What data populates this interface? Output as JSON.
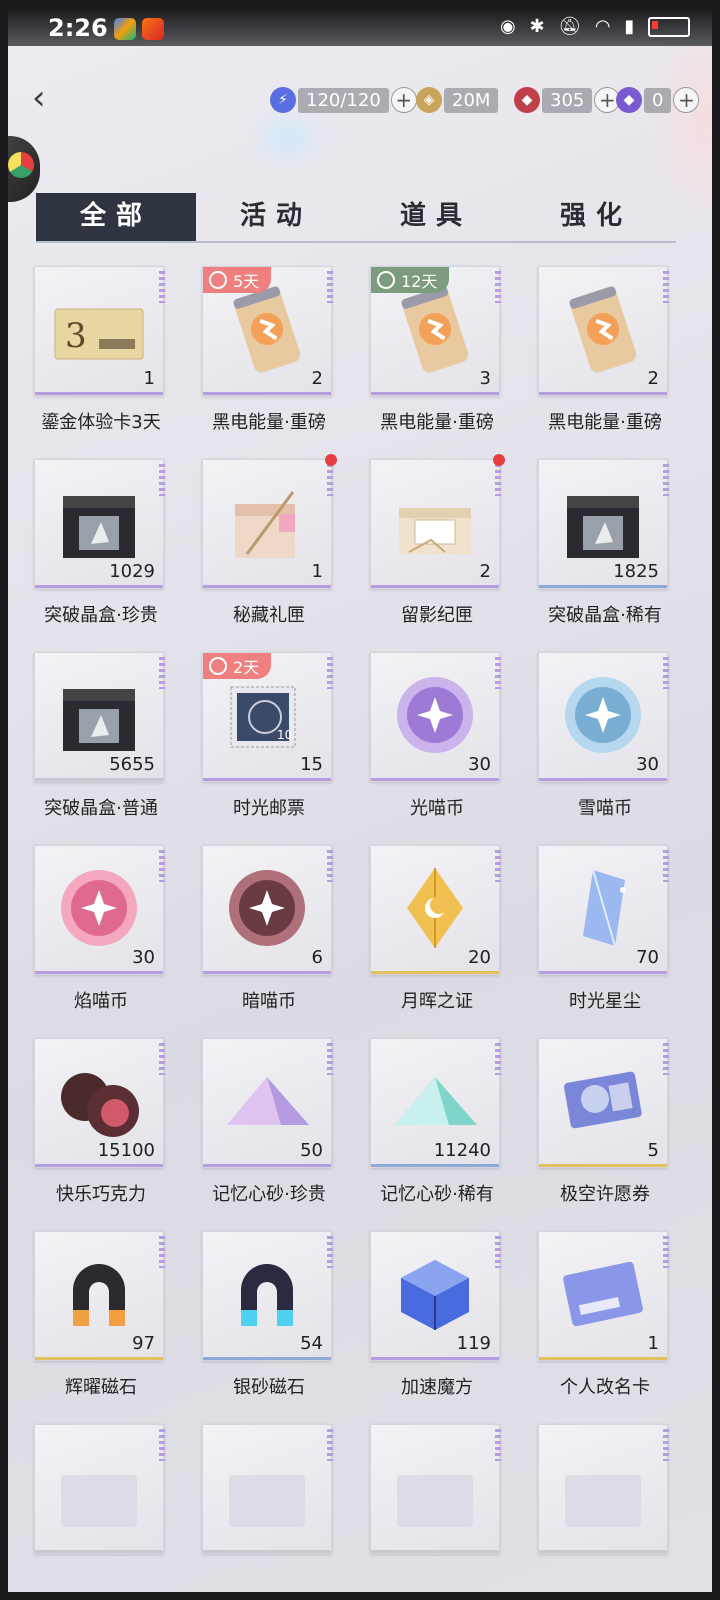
{
  "status": {
    "time": "2:26"
  },
  "resources": [
    {
      "icon": "stamina-icon",
      "value": "120/120",
      "color": "#5b6ee1"
    },
    {
      "icon": "gold-coin-icon",
      "value": "20M",
      "color": "#c9a45a"
    },
    {
      "icon": "red-diamond-icon",
      "value": "305",
      "color": "#c0404a"
    },
    {
      "icon": "purple-diamond-icon",
      "value": "0",
      "color": "#7a5ad0"
    }
  ],
  "tabs": [
    "全部",
    "活动",
    "道具",
    "强化"
  ],
  "active_tab": 0,
  "items": [
    {
      "name": "鎏金体验卡3天",
      "qty": "1",
      "icon": "gold-card-icon",
      "stripe": "#b59ee0"
    },
    {
      "name": "黑电能量·重磅",
      "qty": "2",
      "icon": "energy-can-icon",
      "timer": "5天",
      "timer_color": "#f08080",
      "stripe": "#b59ee0"
    },
    {
      "name": "黑电能量·重磅",
      "qty": "3",
      "icon": "energy-can-icon",
      "timer": "12天",
      "timer_color": "#7d9c7d",
      "stripe": "#b59ee0"
    },
    {
      "name": "黑电能量·重磅",
      "qty": "2",
      "icon": "energy-can-icon",
      "stripe": "#b59ee0"
    },
    {
      "name": "突破晶盒·珍贵",
      "qty": "1029",
      "icon": "crystal-box-icon",
      "stripe": "#b59ee0"
    },
    {
      "name": "秘藏礼匣",
      "qty": "1",
      "icon": "gift-box-icon",
      "dot": true,
      "stripe": "#b59ee0"
    },
    {
      "name": "留影纪匣",
      "qty": "2",
      "icon": "memory-box-icon",
      "dot": true,
      "stripe": "#b59ee0"
    },
    {
      "name": "突破晶盒·稀有",
      "qty": "1825",
      "icon": "crystal-box-icon",
      "stripe": "#8fa8d8"
    },
    {
      "name": "突破晶盒·普通",
      "qty": "5655",
      "icon": "crystal-box-icon",
      "stripe": "#c8c8d0"
    },
    {
      "name": "时光邮票",
      "qty": "15",
      "icon": "stamp-icon",
      "timer": "2天",
      "timer_color": "#f08080",
      "stripe": "#b59ee0"
    },
    {
      "name": "光喵币",
      "qty": "30",
      "icon": "light-coin-icon",
      "stripe": "#b59ee0"
    },
    {
      "name": "雪喵币",
      "qty": "30",
      "icon": "snow-coin-icon",
      "stripe": "#b59ee0"
    },
    {
      "name": "焰喵币",
      "qty": "30",
      "icon": "flame-coin-icon",
      "stripe": "#b59ee0"
    },
    {
      "name": "暗喵币",
      "qty": "6",
      "icon": "dark-coin-icon",
      "stripe": "#b59ee0"
    },
    {
      "name": "月晖之证",
      "qty": "20",
      "icon": "moon-crystal-icon",
      "stripe": "#e0c060"
    },
    {
      "name": "时光星尘",
      "qty": "70",
      "icon": "star-dust-icon",
      "stripe": "#b59ee0"
    },
    {
      "name": "快乐巧克力",
      "qty": "15100",
      "icon": "chocolate-icon",
      "stripe": "#b59ee0"
    },
    {
      "name": "记忆心砂·珍贵",
      "qty": "50",
      "icon": "heart-sand-purple-icon",
      "stripe": "#b59ee0"
    },
    {
      "name": "记忆心砂·稀有",
      "qty": "11240",
      "icon": "heart-sand-teal-icon",
      "stripe": "#8fa8d8"
    },
    {
      "name": "极空许愿券",
      "qty": "5",
      "icon": "wish-ticket-icon",
      "stripe": "#e0c060"
    },
    {
      "name": "辉曜磁石",
      "qty": "97",
      "icon": "gold-magnet-icon",
      "stripe": "#e0c060"
    },
    {
      "name": "银砂磁石",
      "qty": "54",
      "icon": "silver-magnet-icon",
      "stripe": "#8fa8d8"
    },
    {
      "name": "加速魔方",
      "qty": "119",
      "icon": "speed-cube-icon",
      "stripe": "#b59ee0"
    },
    {
      "name": "个人改名卡",
      "qty": "1",
      "icon": "rename-card-icon",
      "stripe": "#e0c060"
    },
    {
      "name": "",
      "qty": "",
      "icon": "device-icon",
      "stripe": "#c8c8d0"
    },
    {
      "name": "",
      "qty": "",
      "icon": "pink-card-icon",
      "stripe": "#c8c8d0"
    },
    {
      "name": "",
      "qty": "",
      "icon": "sticker-icon",
      "stripe": "#c8c8d0"
    },
    {
      "name": "",
      "qty": "",
      "icon": "yellow-card-icon",
      "stripe": "#c8c8d0"
    }
  ]
}
